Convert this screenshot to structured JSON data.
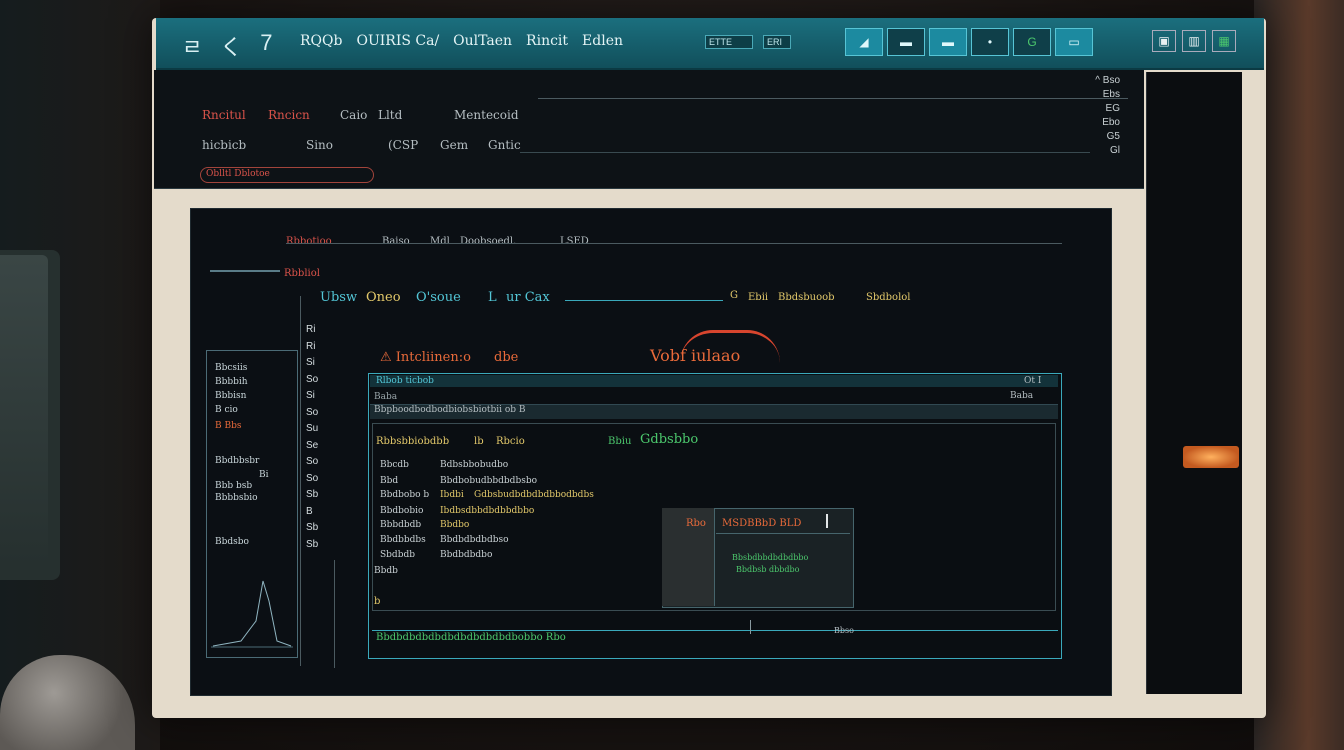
{
  "title_bar": {
    "nav": [
      "ㄹ",
      "く",
      "7"
    ],
    "menu": [
      "RQQb",
      "OUIRIS Ca/",
      "OulTaen",
      "Rincit",
      "Edlen"
    ],
    "indicators": [
      "ETTE",
      "ERI"
    ],
    "toolbar_icons": [
      "◢",
      "▬",
      "▬",
      "•",
      "G",
      "▭"
    ],
    "window_controls": [
      "▣",
      "▥",
      "▦"
    ]
  },
  "top_panel": {
    "row1": [
      "Rncitul",
      "Rncicn",
      "Caio",
      "Lltd",
      "Mentecoid"
    ],
    "row2": [
      "hicbicb",
      "Sino",
      "(CSP",
      "Gem",
      "Gntic"
    ],
    "tab_label": "Oblltl  Dblotoe",
    "right_col": [
      "^  Bso",
      "Ebs",
      "EG",
      "Ebo",
      "G5",
      "Gl"
    ]
  },
  "main": {
    "header": [
      "Rbbotioo",
      "Baiso",
      "Mdl",
      "Doobsoedl.",
      "LSED"
    ],
    "sub_header": "Rbbliol",
    "title_row": [
      "Ubsw",
      "Oneo",
      "O'soue",
      "L",
      "ur Cax"
    ],
    "title_right": [
      "G",
      "Ebii",
      "Bbdsbuoob",
      "Sbdbolol"
    ],
    "warning": [
      "⚠ Intcliinen:o",
      "dbe",
      "Vobf iulaao"
    ],
    "numbers": [
      "Ri",
      "Ri",
      "",
      "Si",
      "",
      "So",
      "Si",
      "So",
      "Su",
      "Se",
      "So",
      "So",
      "",
      "Sb",
      "B",
      "Sb",
      "Sb"
    ]
  },
  "left_mini": [
    "Bbcsiis",
    "Bbbbih",
    "Bbbisn",
    "B cio",
    "B Bbs",
    "Bbdbbsbr",
    "Bi",
    "Bbb bsb",
    "Bbbbsbio",
    "Bbdsbo"
  ],
  "inner_window": {
    "header": "Rlbob ticbob",
    "header_right": "Ot  I",
    "sub": "Bbpboodbodbodbiobsbiotbii ob B",
    "sub_right": "Baba",
    "line1": [
      "Rbbsbbiobdbb",
      "lb",
      "Rbcio"
    ],
    "line1_green": "Bbiu",
    "line1_green2": "Gdbsbbo",
    "rows": [
      {
        "a": "Bbcdb",
        "b": "Bdbsbbobudbo",
        "c": ""
      },
      {
        "a": "Bbd",
        "b": "Bbdbobudbbdbdbsbo",
        "c": ""
      },
      {
        "a": "Bbdbobo  b",
        "b": "Ibdbi",
        "c": "Gdbsbudbdbdbdbbodbdbs"
      },
      {
        "a": "Bbdbobio",
        "b": "Ibdbsdbbdbdbbdbbo",
        "c": ""
      },
      {
        "a": "Bbbdbdb",
        "b": "Bbdbo",
        "c": ""
      },
      {
        "a": "Bbdbbdbs",
        "b": "Bbdbdbdbdbso",
        "c": ""
      },
      {
        "a": "Sbdbdb",
        "b": "Bbdbdbdbo",
        "c": ""
      },
      {
        "a": "Bbdb",
        "b": "",
        "c": ""
      }
    ],
    "footer": "Bbdbdbdbdbdbdbdbdbdbdbobbo  Rbo",
    "footer_right": "Bbso"
  },
  "dialog": {
    "label_left": "Rbo",
    "title": "MSDBBbD BLD",
    "lines": [
      "Bbsbdbbdbdbdbbo",
      "Bbdbsb dbbdbo"
    ]
  },
  "colors": {
    "accent_teal": "#1b6f7e",
    "accent_red": "#d9534a",
    "accent_yellow": "#e2c86a",
    "accent_green": "#4cc86d",
    "accent_cyan": "#53c6d6"
  }
}
